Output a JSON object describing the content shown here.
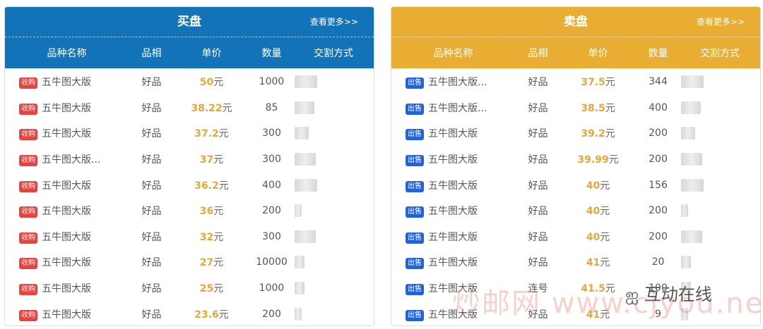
{
  "buy_panel": {
    "title": "买盘",
    "more": "查看更多>>",
    "headers": [
      "品种名称",
      "品相",
      "单价",
      "数量",
      "交割方式"
    ],
    "tag": "收购",
    "unit": "元",
    "rows": [
      {
        "name": "五牛图大版",
        "grade": "好品",
        "price": "50",
        "qty": "1000"
      },
      {
        "name": "五牛图大版",
        "grade": "好品",
        "price": "38.22",
        "qty": "85"
      },
      {
        "name": "五牛图大版",
        "grade": "好品",
        "price": "37.2",
        "qty": "300"
      },
      {
        "name": "五牛图大版...",
        "grade": "好品",
        "price": "37",
        "qty": "300"
      },
      {
        "name": "五牛图大版",
        "grade": "好品",
        "price": "36.2",
        "qty": "400"
      },
      {
        "name": "五牛图大版",
        "grade": "好品",
        "price": "36",
        "qty": "200"
      },
      {
        "name": "五牛图大版",
        "grade": "好品",
        "price": "32",
        "qty": "300"
      },
      {
        "name": "五牛图大版",
        "grade": "好品",
        "price": "27",
        "qty": "10000"
      },
      {
        "name": "五牛图大版",
        "grade": "好品",
        "price": "25",
        "qty": "1000"
      },
      {
        "name": "五牛图大版",
        "grade": "好品",
        "price": "23.6",
        "qty": "200"
      }
    ]
  },
  "sell_panel": {
    "title": "卖盘",
    "more": "查看更多>>",
    "headers": [
      "品种名称",
      "品相",
      "单价",
      "数量",
      "交割方式"
    ],
    "tag": "出售",
    "unit": "元",
    "rows": [
      {
        "name": "五牛图大版...",
        "grade": "好品",
        "price": "37.5",
        "qty": "344"
      },
      {
        "name": "五牛图大版...",
        "grade": "好品",
        "price": "38.5",
        "qty": "400"
      },
      {
        "name": "五牛图大版",
        "grade": "好品",
        "price": "39.2",
        "qty": "200"
      },
      {
        "name": "五牛图大版",
        "grade": "好品",
        "price": "39.99",
        "qty": "200"
      },
      {
        "name": "五牛图大版",
        "grade": "好品",
        "price": "40",
        "qty": "156"
      },
      {
        "name": "五牛图大版",
        "grade": "好品",
        "price": "40",
        "qty": "200"
      },
      {
        "name": "五牛图大版",
        "grade": "好品",
        "price": "40",
        "qty": "200"
      },
      {
        "name": "五牛图大版",
        "grade": "好品",
        "price": "41",
        "qty": "20"
      },
      {
        "name": "五牛图大版",
        "grade": "连号",
        "price": "41.5",
        "qty": "100"
      },
      {
        "name": "五牛图大版",
        "grade": "好品",
        "price": "41",
        "qty": "9"
      }
    ]
  },
  "watermark": "炒邮网 www.cjyou.net",
  "wechat_label": "互动在线",
  "colors": {
    "buy_header": "#1373b8",
    "sell_header": "#e9ad34",
    "price": "#e9a63b",
    "buy_tag": "#e8433f",
    "sell_tag": "#2163dc"
  }
}
